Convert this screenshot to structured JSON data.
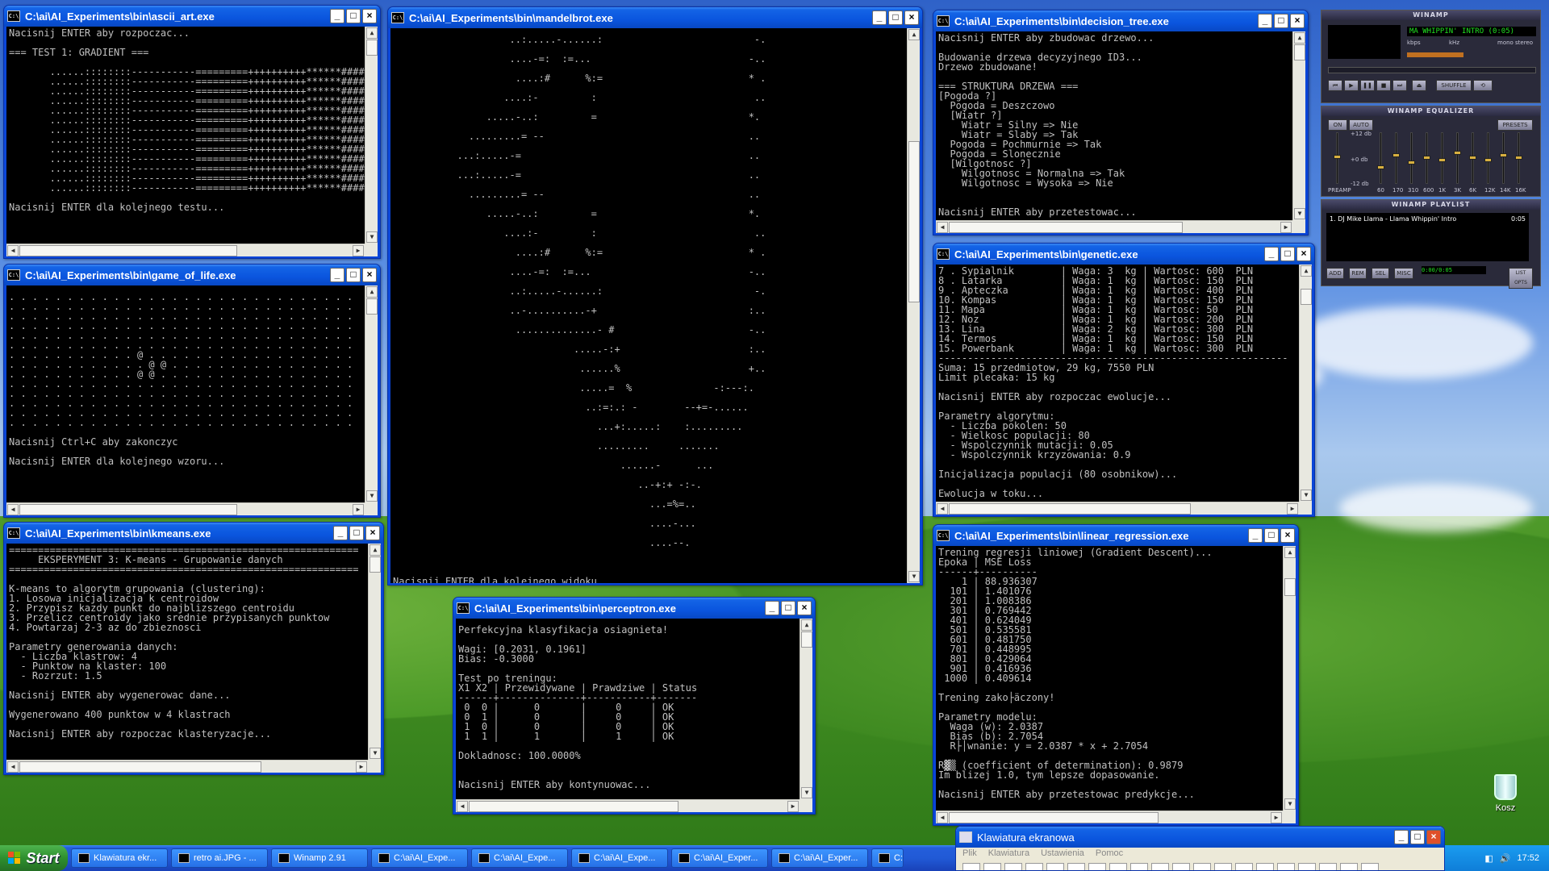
{
  "windows": {
    "ascii_art": {
      "title": "C:\\ai\\AI_Experiments\\bin\\ascii_art.exe",
      "text": "Nacisnij ENTER aby rozpoczac...\n\n=== TEST 1: GRADIENT ===\n\n       ......::::::::-----------=========++++++++++******######%\n       ......::::::::-----------=========++++++++++******######%\n       ......::::::::-----------=========++++++++++******######%\n       ......::::::::-----------=========++++++++++******######%\n       ......::::::::-----------=========++++++++++******######%\n       ......::::::::-----------=========++++++++++******######%\n       ......::::::::-----------=========++++++++++******######%\n       ......::::::::-----------=========++++++++++******######%\n       ......::::::::-----------=========++++++++++******######%\n       ......::::::::-----------=========++++++++++******######%\n       ......::::::::-----------=========++++++++++******######%\n       ......::::::::-----------=========++++++++++******######%\n       ......::::::::-----------=========++++++++++******######%\n\nNacisnij ENTER dla kolejnego testu..."
    },
    "game_of_life": {
      "title": "C:\\ai\\AI_Experiments\\bin\\game_of_life.exe",
      "text": ". . . . . . . . . . . . . . . . . . . . . . . . . . . . . .\n. . . . . . . . . . . . . . . . . . . . . . . . . . . . . .\n. . . . . . . . . . . . . . . . . . . . . . . . . . . . . .\n. . . . . . . . . . . . . . . . . . . . . . . . . . . . . .\n. . . . . . . . . . . . . . . . . . . . . . . . . . . . . .\n. . . . . . . . . . . . . . . . . . . . . . . . . . . . . .\n. . . . . . . . . . . @ . . . . . . . . . . . . . . . . . .\n. . . . . . . . . . . . @ @ . . . . . . . . . . . . . . . .\n. . . . . . . . . . . @ @ . . . . . . . . . . . . . . . . .\n. . . . . . . . . . . . . . . . . . . . . . . . . . . . . .\n. . . . . . . . . . . . . . . . . . . . . . . . . . . . . .\n. . . . . . . . . . . . . . . . . . . . . . . . . . . . . .\n. . . . . . . . . . . . . . . . . . . . . . . . . . . . . .\n. . . . . . . . . . . . . . . . . . . . . . . . . . . . . .\n\nNacisnij Ctrl+C aby zakonczyc\n\nNacisnij ENTER dla kolejnego wzoru..."
    },
    "kmeans": {
      "title": "C:\\ai\\AI_Experiments\\bin\\kmeans.exe",
      "text": "============================================================\n     EKSPERYMENT 3: K-means - Grupowanie danych\n============================================================\n\nK-means to algorytm grupowania (clustering):\n1. Losowa inicjalizacja k centroidow\n2. Przypisz kazdy punkt do najblizszego centroidu\n3. Przelicz centroidy jako srednie przypisanych punktow\n4. Powtarzaj 2-3 az do zbieznosci\n\nParametry generowania danych:\n  - Liczba klastrow: 4\n  - Punktow na klaster: 100\n  - Rozrzut: 1.5\n\nNacisnij ENTER aby wygenerowac dane...\n\nWygenerowano 400 punktow w 4 klastrach\n\nNacisnij ENTER aby rozpoczac klasteryzacje..."
    },
    "mandelbrot": {
      "title": "C:\\ai\\AI_Experiments\\bin\\mandelbrot.exe",
      "text": "                    ..:.....-......:                          -.\n                    ....-=:  :=...                           -..\n                     ....:#      %:=                         * .\n                   ....:-         :                           ..\n                .....-..:         =                          *.\n             .........= --                                   ..\n           ...:.....-=                                       ..\n           ...:.....-=                                       ..\n             .........= --                                   ..\n                .....-..:         =                          *.\n                   ....:-         :                           ..\n                     ....:#      %:=                         * .\n                    ....-=:  :=...                           -..\n                    ..:.....-......:                          -.\n                    ..-..........-+                          :..\n                     ..............- #                       -..\n                               .....-:+                      :..\n                                ......%                      +..\n                                .....=  %              -:---:.\n                                 ..:=:.: -        --+=-......\n                                   ...+:.....:    :.........\n                                   .........     .......\n                                       ......-      ...\n                                          ..-+:+ -:-.\n                                            ...=%=..\n                                            ....-...\n                                            ....--.\n\nNacisnij ENTER dla kolejnego widoku..."
    },
    "perceptron": {
      "title": "C:\\ai\\AI_Experiments\\bin\\perceptron.exe",
      "text": "Perfekcyjna klasyfikacja osiagnieta!\n\nWagi: [0.2031, 0.1961]\nBias: -0.3000\n\nTest po treningu:\nX1 X2 | Przewidywane | Prawdziwe | Status\n------+--------------+-----------+-------\n 0  0 |      0       |     0     | OK\n 0  1 |      0       |     0     | OK\n 1  0 |      0       |     0     | OK\n 1  1 |      1       |     1     | OK\n\nDokladnosc: 100.0000%\n\n\nNacisnij ENTER aby kontynuowac..."
    },
    "decision_tree": {
      "title": "C:\\ai\\AI_Experiments\\bin\\decision_tree.exe",
      "text": "Nacisnij ENTER aby zbudowac drzewo...\n\nBudowanie drzewa decyzyjnego ID3...\nDrzewo zbudowane!\n\n=== STRUKTURA DRZEWA ===\n[Pogoda ?]\n  Pogoda = Deszczowo\n  [Wiatr ?]\n    Wiatr = Silny => Nie\n    Wiatr = Slaby => Tak\n  Pogoda = Pochmurnie => Tak\n  Pogoda = Slonecznie\n  [Wilgotnosc ?]\n    Wilgotnosc = Normalna => Tak\n    Wilgotnosc = Wysoka => Nie\n\n\nNacisnij ENTER aby przetestowac..."
    },
    "genetic": {
      "title": "C:\\ai\\AI_Experiments\\bin\\genetic.exe",
      "text": "7 . Sypialnik        | Waga: 3  kg | Wartosc: 600  PLN\n8 . Latarka          | Waga: 1  kg | Wartosc: 150  PLN\n9 . Apteczka         | Waga: 1  kg | Wartosc: 400  PLN\n10. Kompas           | Waga: 1  kg | Wartosc: 150  PLN\n11. Mapa             | Waga: 1  kg | Wartosc: 50   PLN\n12. Noz              | Waga: 1  kg | Wartosc: 200  PLN\n13. Lina             | Waga: 2  kg | Wartosc: 300  PLN\n14. Termos           | Waga: 1  kg | Wartosc: 150  PLN\n15. Powerbank        | Waga: 1  kg | Wartosc: 300  PLN\n------------------------------------------------------------\nSuma: 15 przedmiotow, 29 kg, 7550 PLN\nLimit plecaka: 15 kg\n\nNacisnij ENTER aby rozpoczac ewolucje...\n\nParametry algorytmu:\n  - Liczba pokolen: 50\n  - Wielkosc populacji: 80\n  - Wspolczynnik mutacji: 0.05\n  - Wspolczynnik krzyzowania: 0.9\n\nInicjalizacja populacji (80 osobnikow)...\n\nEwolucja w toku..."
    },
    "linear_regression": {
      "title": "C:\\ai\\AI_Experiments\\bin\\linear_regression.exe",
      "text": "Trening regresji liniowej (Gradient Descent)...\nEpoka | MSE Loss\n------+----------\n    1 | 88.936307\n  101 | 1.401076\n  201 | 1.008386\n  301 | 0.769442\n  401 | 0.624049\n  501 | 0.535581\n  601 | 0.481750\n  701 | 0.448995\n  801 | 0.429064\n  901 | 0.416936\n 1000 | 0.409614\n\nTrening zako├äczony!\n\nParametry modelu:\n  Waga (w): 2.0387\n  Bias (b): 2.7054\n  R├│wnanie: y = 2.0387 * x + 2.7054\n\nR▓▒ (coefficient of determination): 0.9879\nIm blizej 1.0, tym lepsze dopasowanie.\n\nNacisnij ENTER aby przetestowac predykcje..."
    }
  },
  "winamp": {
    "main_title": "WINAMP",
    "song": "MA WHIPPIN' INTRO (0:05)",
    "kbps_label": "kbps",
    "khz_label": "kHz",
    "mono_label": "mono",
    "stereo_label": "stereo",
    "shuffle_label": "SHUFFLE",
    "eq_title": "WINAMP EQUALIZER",
    "eq_on": "ON",
    "eq_auto": "AUTO",
    "eq_presets": "PRESETS",
    "eq_preamp": "PREAMP",
    "eq_db_top": "+12 db",
    "eq_db_mid": "+0 db",
    "eq_db_bot": "-12 db",
    "eq_bands": [
      "60",
      "170",
      "310",
      "600",
      "1K",
      "3K",
      "6K",
      "12K",
      "14K",
      "16K"
    ],
    "eq_levels": [
      0.3,
      0.55,
      0.4,
      0.5,
      0.45,
      0.6,
      0.5,
      0.45,
      0.55,
      0.5
    ],
    "playlist_title": "WINAMP PLAYLIST",
    "playlist_item": "1. DJ Mike Llama - Llama Whippin' Intro",
    "playlist_time": "0:05",
    "pl_add": "ADD",
    "pl_rem": "REM",
    "pl_sel": "SEL",
    "pl_misc": "MISC",
    "pl_list": "LIST OPTS",
    "pl_counter": "0:00/0:05"
  },
  "keyboard": {
    "title": "Klawiatura ekranowa",
    "menu": [
      "Plik",
      "Klawiatura",
      "Ustawienia",
      "Pomoc"
    ]
  },
  "taskbar": {
    "start": "Start",
    "tasks": [
      "Klawiatura ekr...",
      "retro ai.JPG - ...",
      "Winamp 2.91",
      "C:\\ai\\AI_Expe...",
      "C:\\ai\\AI_Expe...",
      "C:\\ai\\AI_Expe...",
      "C:\\ai\\AI_Exper...",
      "C:\\ai\\AI_Exper...",
      "C:\\ai"
    ],
    "clock": "17:52"
  },
  "desktop": {
    "recycle_bin": "Kosz"
  }
}
